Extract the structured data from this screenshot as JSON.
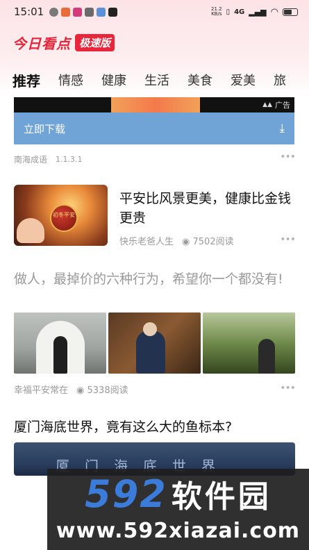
{
  "status_bar": {
    "time": "15:01",
    "net_speed": "21.2\nKB/s",
    "network": "4G",
    "colors": {
      "icon1": "#7a7a7a",
      "icon2": "#e96b3a",
      "icon3": "#d23a7a",
      "icon4": "#6a6a6a",
      "icon5": "#5b8fd8",
      "icon6": "#222222"
    }
  },
  "app": {
    "name": "今日看点",
    "badge": "极速版",
    "accent": "#e8253a"
  },
  "tabs": [
    "推荐",
    "情感",
    "健康",
    "生活",
    "美食",
    "爱美",
    "旅"
  ],
  "ad": {
    "tag": "广告",
    "cta_label": "立即下载",
    "download_icon": "download-icon",
    "source": "南海成语",
    "version": "1.1.3.1",
    "bar_color": "#70a3d6"
  },
  "articles": [
    {
      "title": "平安比风景更美，健康比金钱更贵",
      "author": "快乐老爸人生",
      "reads": "7502阅读",
      "thumb_text": "初冬平安"
    },
    {
      "title": "做人，最掉价的六种行为，希望你一个都没有!",
      "author": "幸福平安常在",
      "reads": "5338阅读"
    },
    {
      "title": "厦门海底世界，竟有这么大的鱼标本?",
      "image_sign": "厦门海底世界"
    }
  ],
  "watermark": {
    "number": "592",
    "name": "软件园",
    "url": "www.592xiazai.com"
  }
}
